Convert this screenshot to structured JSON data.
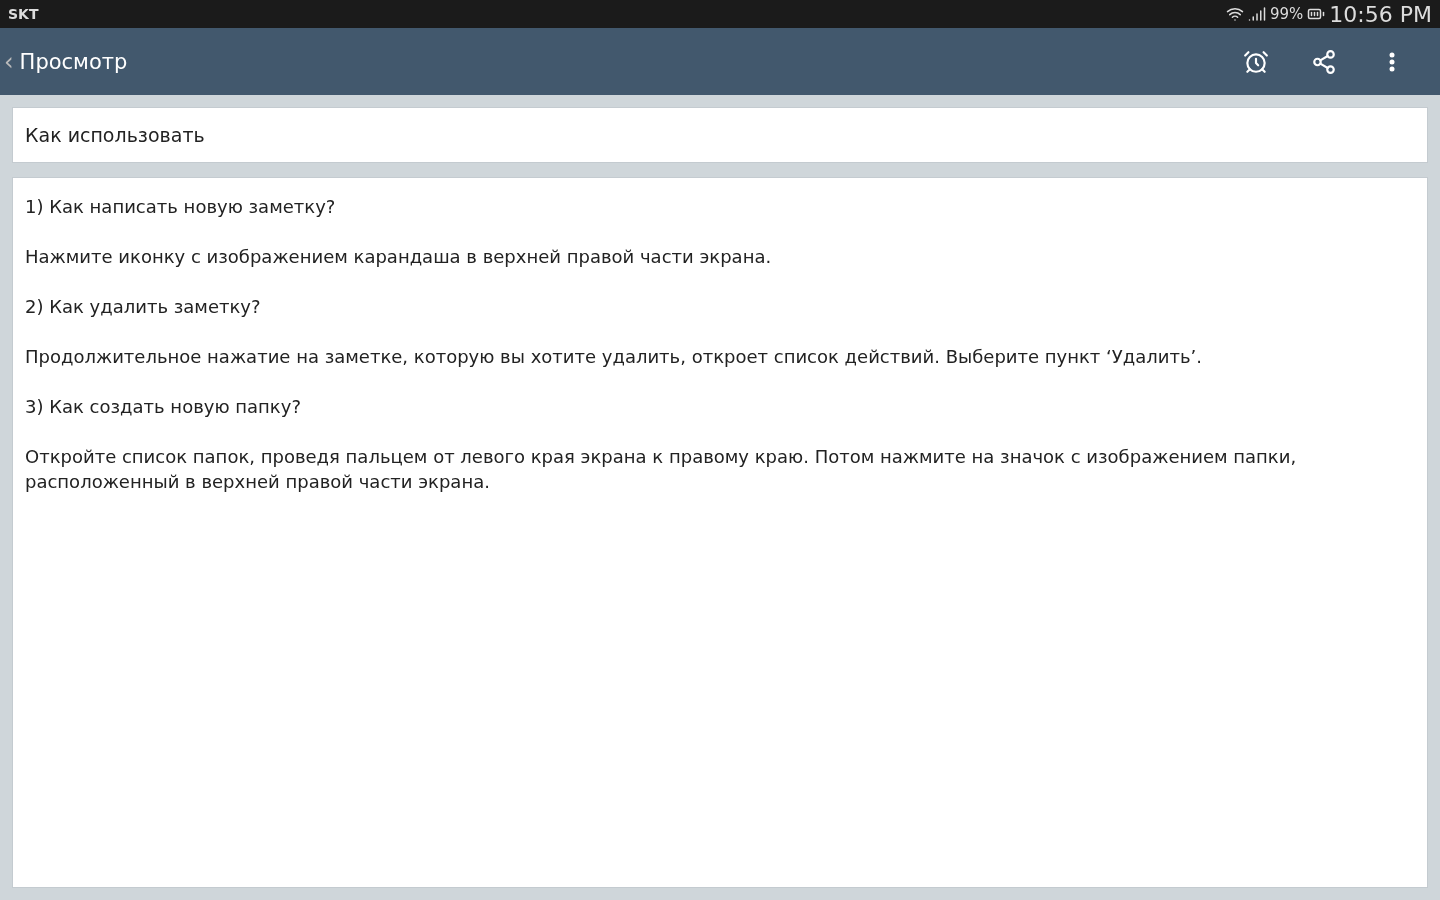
{
  "status_bar": {
    "carrier": "SKT",
    "battery": "99%",
    "time": "10:56 PM"
  },
  "app_bar": {
    "back": "‹",
    "title": "Просмотр"
  },
  "note": {
    "title": "Как использовать",
    "paragraphs": [
      "1) Как написать новую заметку?",
      "Нажмите иконку с изображением карандаша в верхней правой части экрана.",
      "2) Как удалить заметку?",
      "Продолжительное нажатие на заметке, которую вы хотите удалить, откроет список действий. Выберите пункт ‘Удалить’.",
      "3) Как создать новую папку?",
      "Откройте список папок, проведя пальцем от левого края экрана к правому краю. Потом нажмите на значок с изображением папки, расположенный в верхней правой части экрана."
    ]
  }
}
